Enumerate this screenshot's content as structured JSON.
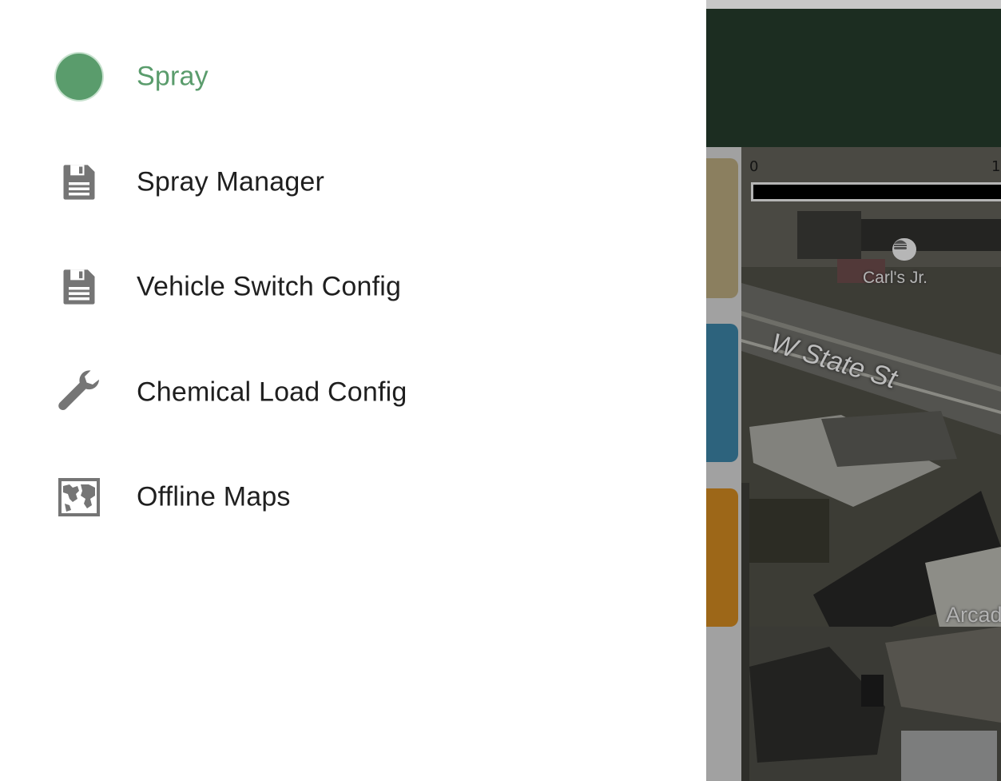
{
  "drawer": {
    "items": [
      {
        "label": "Spray",
        "icon": "circle-icon",
        "active": true
      },
      {
        "label": "Spray Manager",
        "icon": "save-icon",
        "active": false
      },
      {
        "label": "Vehicle Switch Config",
        "icon": "save-icon",
        "active": false
      },
      {
        "label": "Chemical Load Config",
        "icon": "wrench-icon",
        "active": false
      },
      {
        "label": "Offline Maps",
        "icon": "map-icon",
        "active": false
      }
    ]
  },
  "map": {
    "scale_start": "0",
    "scale_end": "1",
    "poi_label": "Carl's Jr.",
    "poi_icon": "burger-icon",
    "street_label": "W State St",
    "area_label": "Arcad"
  },
  "colors": {
    "accent": "#5a9c6c",
    "app_bar": "#243a2b",
    "side_button_1": "#b3a37a",
    "side_button_2": "#3a7fa0",
    "side_button_3": "#c9841f",
    "icon_gray": "#757575"
  }
}
